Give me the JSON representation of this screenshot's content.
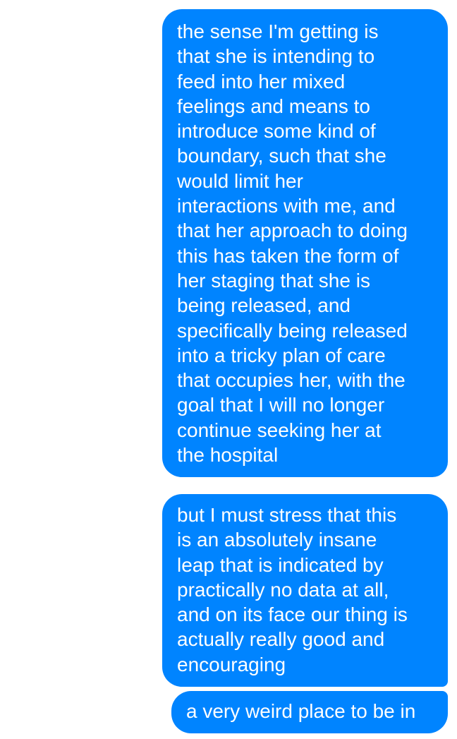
{
  "theme": {
    "bubble_color": "#0084ff",
    "text_color": "#ffffff",
    "background": "#ffffff"
  },
  "messages": [
    {
      "sender": "self",
      "lines": [
        "the sense I'm getting is",
        "that she is intending to",
        "feed into her mixed",
        "feelings and means to",
        "introduce some kind of",
        "boundary, such that she",
        "would limit her",
        "interactions with me, and",
        "that her approach to doing",
        "this has taken the form of",
        "her staging that she is",
        "being released, and",
        "specifically being released",
        "into a tricky plan of care",
        "that occupies her, with the",
        "goal that I will no longer",
        "continue seeking her at",
        "the hospital"
      ]
    },
    {
      "sender": "self",
      "lines": [
        "but I must stress that this",
        "is an absolutely insane",
        "leap that is indicated by",
        "practically no data at all,",
        "and on its face our thing is",
        "actually really good and",
        "encouraging"
      ]
    },
    {
      "sender": "self",
      "lines": [
        "a very weird place to be in"
      ]
    }
  ]
}
